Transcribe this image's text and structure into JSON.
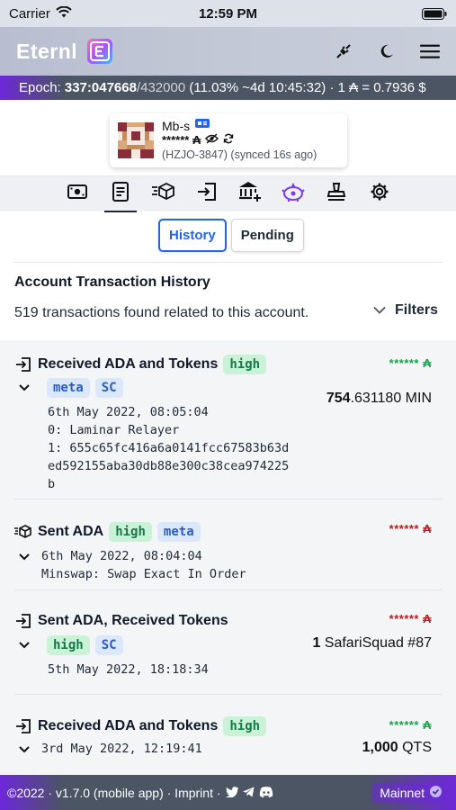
{
  "status_bar": {
    "carrier": "Carrier",
    "time": "12:59 PM"
  },
  "header": {
    "logo": "Eternl",
    "icons": [
      "plug-icon",
      "moon-icon",
      "menu-icon"
    ]
  },
  "epoch": {
    "label": "Epoch:",
    "value": "337:047668",
    "total": "/432000",
    "progress": "(11.03% ~4d 10:45:32) · 1 ₳ = 0.7936 $"
  },
  "wallet": {
    "name": "Mb-s",
    "balance": "****** ₳",
    "sync": "(HZJO-3847) (synced 16s ago)"
  },
  "nav": {
    "tabs": [
      "summary",
      "transactions",
      "send",
      "receive",
      "staking",
      "dapp",
      "voting",
      "settings"
    ],
    "active": "transactions"
  },
  "subtabs": {
    "history": "History",
    "pending": "Pending"
  },
  "section": {
    "title": "Account Transaction History",
    "found": "519 transactions found related to this account.",
    "filters": "Filters"
  },
  "transactions": [
    {
      "title": "Received ADA and Tokens",
      "badges": [
        "high"
      ],
      "tags": [
        "meta",
        "SC"
      ],
      "amount_ada": "****** ₳",
      "token_amount_bold": "754",
      "token_amount_rest": ".631180 MIN",
      "details": "6th May 2022, 08:05:04\n0: Laminar Relayer\n1: 655c65fc416a6a0141fcc67583b63d\ned592155aba30db88e300c38cea974225\nb"
    },
    {
      "title": "Sent ADA",
      "badges": [
        "high",
        "meta"
      ],
      "amount_ada": "****** ₳",
      "details": "6th May 2022, 08:04:04\nMinswap: Swap Exact In Order"
    },
    {
      "title": "Sent ADA, Received Tokens",
      "tags": [
        "high",
        "SC"
      ],
      "amount_ada": "****** ₳",
      "token_amount_bold": "1",
      "token_amount_rest": " SafariSquad #87",
      "details": "5th May 2022, 18:18:34"
    },
    {
      "title": "Received ADA and Tokens",
      "badges": [
        "high"
      ],
      "amount_ada": "****** ₳",
      "token_amount_bold": "1,000",
      "token_amount_rest": " QTS",
      "details": "3rd May 2022, 12:19:41"
    }
  ],
  "footer": {
    "copyright": "©2022 · v1.7.0 (mobile app) · Imprint ·",
    "network": "Mainnet"
  },
  "colors": {
    "accent": "#2563eb",
    "brand_purple": "#6d28d9",
    "positive": "#16a34a",
    "negative": "#b91c1c"
  }
}
